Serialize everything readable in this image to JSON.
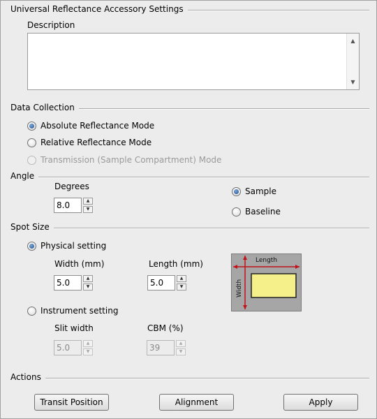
{
  "window": {
    "title": "Universal Reflectance Accessory Settings"
  },
  "description": {
    "label": "Description",
    "value": ""
  },
  "data_collection": {
    "label": "Data Collection",
    "modes": [
      {
        "label": "Absolute Reflectance Mode",
        "selected": true,
        "enabled": true
      },
      {
        "label": "Relative Reflectance Mode",
        "selected": false,
        "enabled": true
      },
      {
        "label": "Transmission (Sample Compartment) Mode",
        "selected": false,
        "enabled": false
      }
    ]
  },
  "angle": {
    "label": "Angle",
    "degrees_label": "Degrees",
    "degrees_value": "8.0",
    "options": [
      {
        "label": "Sample",
        "selected": true
      },
      {
        "label": "Baseline",
        "selected": false
      }
    ]
  },
  "spot_size": {
    "label": "Spot Size",
    "physical": {
      "label": "Physical setting",
      "selected": true,
      "width_label": "Width (mm)",
      "width_value": "5.0",
      "length_label": "Length (mm)",
      "length_value": "5.0"
    },
    "instrument": {
      "label": "Instrument setting",
      "selected": false,
      "slit_label": "Slit width",
      "slit_value": "5.0",
      "cbm_label": "CBM (%)",
      "cbm_value": "39"
    },
    "diagram": {
      "length_label": "Length",
      "width_label": "Width"
    }
  },
  "actions": {
    "label": "Actions",
    "transit_label": "Transit Position",
    "alignment_label": "Alignment",
    "apply_label": "Apply"
  },
  "colors": {
    "radio_selected": "#1e4f8c",
    "sample_fill": "#f5f08a",
    "arrow": "#c0141a",
    "diagram_bg": "#a6a6a6"
  },
  "icons": {
    "scroll_up": "triangle-up",
    "scroll_down": "triangle-down",
    "spin_up": "triangle-up",
    "spin_down": "triangle-down"
  }
}
